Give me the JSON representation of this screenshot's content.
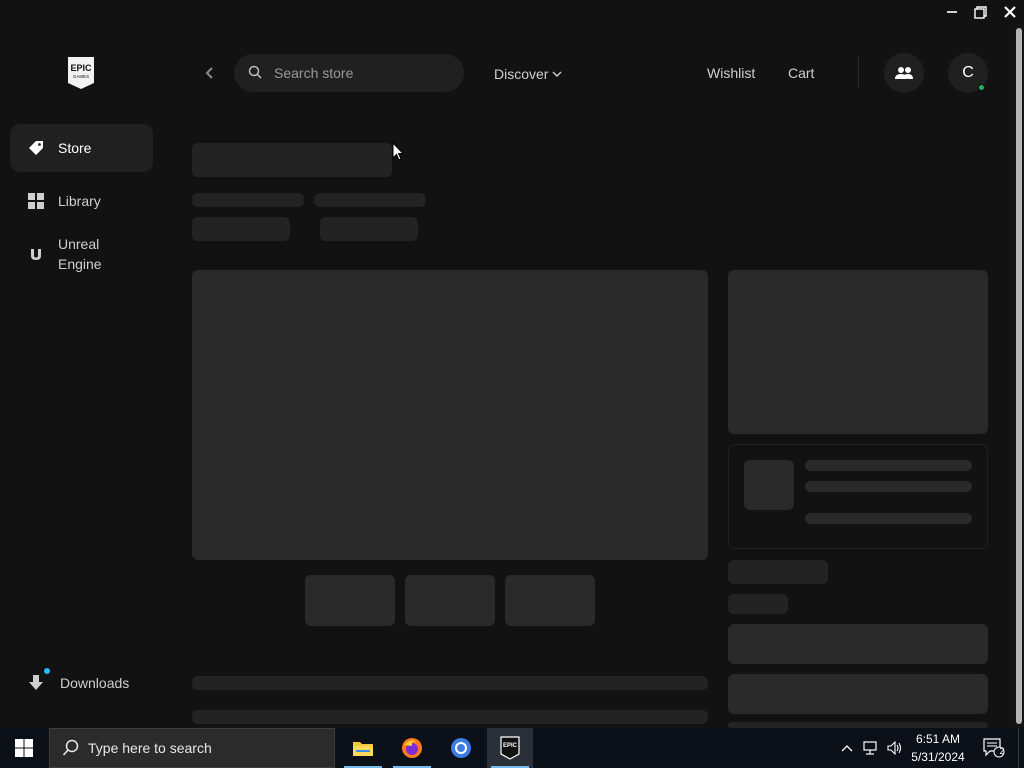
{
  "window": {
    "minimize_glyph": "—",
    "restore_glyph": "❐",
    "close_glyph": "✕"
  },
  "sidebar": {
    "logo_text": "EPIC",
    "logo_subtext": "GAMES",
    "items": [
      {
        "label": "Store",
        "icon": "tag-icon",
        "active": true
      },
      {
        "label": "Library",
        "icon": "grid-icon",
        "active": false
      },
      {
        "label": "Unreal Engine",
        "icon": "unreal-icon",
        "active": false
      }
    ],
    "downloads_label": "Downloads"
  },
  "header": {
    "search_placeholder": "Search store",
    "discover_label": "Discover",
    "wishlist_label": "Wishlist",
    "cart_label": "Cart",
    "avatar_initial": "C"
  },
  "taskbar": {
    "search_placeholder": "Type here to search",
    "time": "6:51 AM",
    "date": "5/31/2024",
    "notification_count": "2",
    "apps": [
      "file-explorer",
      "firefox",
      "chrome",
      "epic-games-launcher"
    ]
  },
  "colors": {
    "background": "#121212",
    "surface": "#202020",
    "skeleton": "#232323",
    "online_status": "#1fb35c",
    "accent": "#26bbff"
  }
}
